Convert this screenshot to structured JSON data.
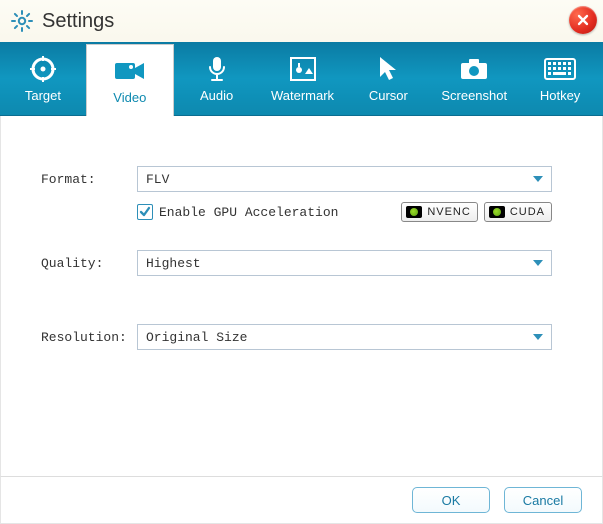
{
  "window": {
    "title": "Settings"
  },
  "tabs": [
    {
      "label": "Target"
    },
    {
      "label": "Video"
    },
    {
      "label": "Audio"
    },
    {
      "label": "Watermark"
    },
    {
      "label": "Cursor"
    },
    {
      "label": "Screenshot"
    },
    {
      "label": "Hotkey"
    }
  ],
  "activeTab": "Video",
  "form": {
    "format": {
      "label": "Format:",
      "value": "FLV",
      "gpuCheckbox": {
        "checked": true,
        "label": "Enable GPU Acceleration"
      },
      "badges": {
        "nvenc": "NVENC",
        "cuda": "CUDA"
      }
    },
    "quality": {
      "label": "Quality:",
      "value": "Highest"
    },
    "resolution": {
      "label": "Resolution:",
      "value": "Original Size"
    }
  },
  "buttons": {
    "ok": "OK",
    "cancel": "Cancel"
  }
}
